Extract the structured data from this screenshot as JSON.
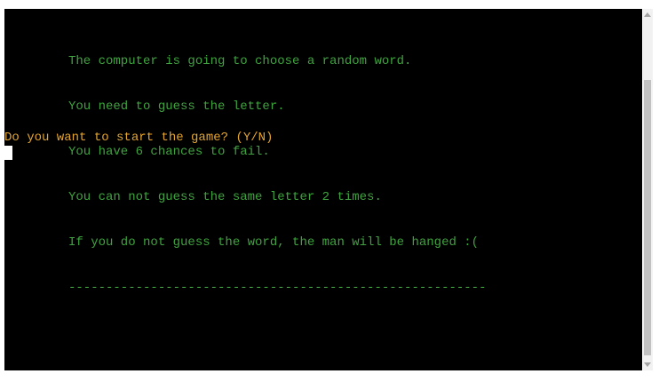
{
  "terminal": {
    "intro_lines": [
      "The computer is going to choose a random word.",
      "You need to guess the letter.",
      "You have 6 chances to fail.",
      "You can not guess the same letter 2 times.",
      "If you do not guess the word, the man will be hanged :(",
      "--------------------------------------------------------"
    ],
    "prompt": "Do you want to start the game? (Y/N)"
  },
  "colors": {
    "background": "#000000",
    "intro_text": "#3fa33f",
    "prompt_text": "#e3a531",
    "cursor": "#ffffff"
  },
  "icons": {
    "scroll_up": "triangle-up-icon",
    "scroll_down": "triangle-down-icon"
  }
}
